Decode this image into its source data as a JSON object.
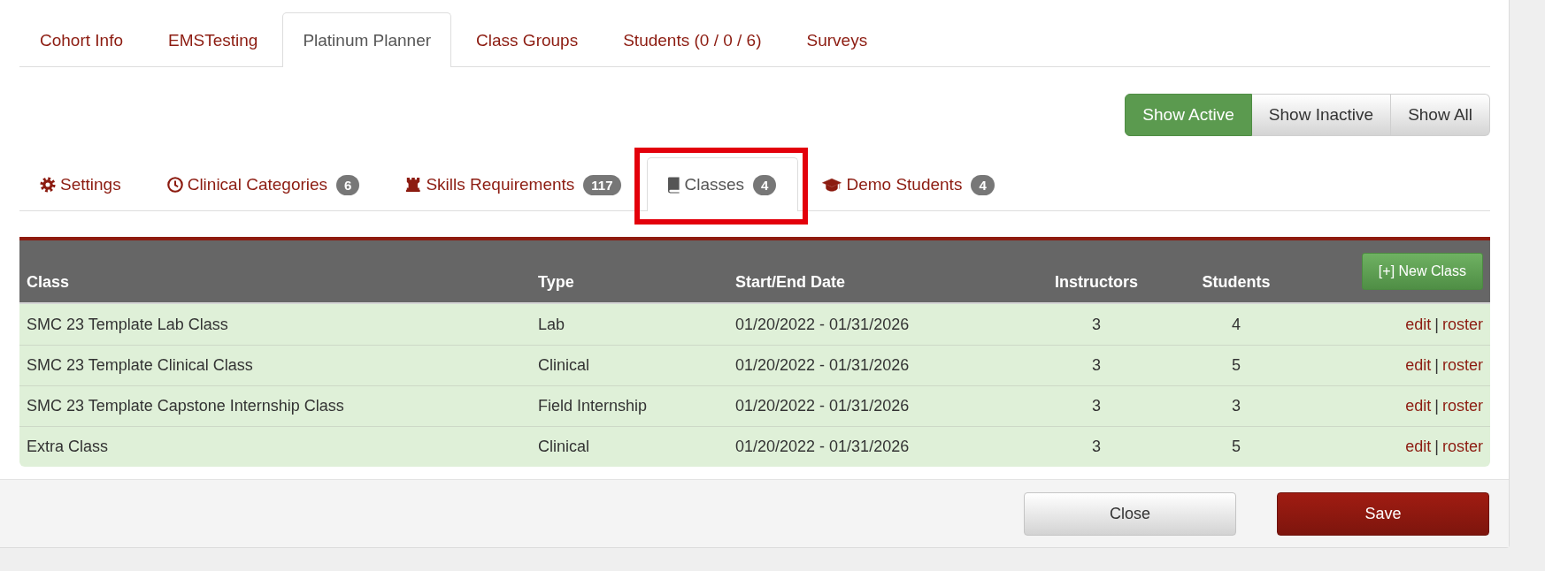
{
  "main_tabs": [
    {
      "label": "Cohort Info",
      "selected": false
    },
    {
      "label": "EMSTesting",
      "selected": false
    },
    {
      "label": "Platinum Planner",
      "selected": true
    },
    {
      "label": "Class Groups",
      "selected": false
    },
    {
      "label": "Students (0 / 0 / 6)",
      "selected": false
    },
    {
      "label": "Surveys",
      "selected": false
    }
  ],
  "filter_buttons": [
    {
      "label": "Show Active",
      "selected": true
    },
    {
      "label": "Show Inactive",
      "selected": false
    },
    {
      "label": "Show All",
      "selected": false
    }
  ],
  "sub_tabs": [
    {
      "label": "Settings",
      "selected": false,
      "highlighted": false
    },
    {
      "label": "Clinical Categories",
      "badge": "6",
      "selected": false,
      "highlighted": false
    },
    {
      "label": "Skills Requirements",
      "badge": "117",
      "selected": false,
      "highlighted": false
    },
    {
      "label": "Classes",
      "badge": "4",
      "selected": true,
      "highlighted": true
    },
    {
      "label": "Demo Students",
      "badge": "4",
      "selected": false,
      "highlighted": false
    }
  ],
  "table": {
    "columns": [
      "Class",
      "Type",
      "Start/End Date",
      "Instructors",
      "Students"
    ],
    "new_button": "[+] New Class",
    "rows": [
      {
        "class": "SMC 23 Template Lab Class",
        "type": "Lab",
        "dates": "01/20/2022 - 01/31/2026",
        "instructors": "3",
        "students": "4",
        "actions": [
          {
            "label": "edit",
            "kind": "link"
          },
          {
            "label": "|",
            "kind": "separator"
          },
          {
            "label": "roster",
            "kind": "link"
          }
        ]
      },
      {
        "class": "SMC 23 Template Clinical Class",
        "type": "Clinical",
        "dates": "01/20/2022 - 01/31/2026",
        "instructors": "3",
        "students": "5",
        "actions": [
          {
            "label": "edit",
            "kind": "link"
          },
          {
            "label": "|",
            "kind": "separator"
          },
          {
            "label": "roster",
            "kind": "link"
          }
        ]
      },
      {
        "class": "SMC 23 Template Capstone Internship Class",
        "type": "Field Internship",
        "dates": "01/20/2022 - 01/31/2026",
        "instructors": "3",
        "students": "3",
        "actions": [
          {
            "label": "edit",
            "kind": "link"
          },
          {
            "label": "|",
            "kind": "separator"
          },
          {
            "label": "roster",
            "kind": "link"
          }
        ]
      },
      {
        "class": "Extra Class",
        "type": "Clinical",
        "dates": "01/20/2022 - 01/31/2026",
        "instructors": "3",
        "students": "5",
        "actions": [
          {
            "label": "edit",
            "kind": "link"
          },
          {
            "label": "|",
            "kind": "separator"
          },
          {
            "label": "roster",
            "kind": "link"
          }
        ]
      }
    ]
  },
  "footer": {
    "buttons": [
      {
        "label": "Close",
        "kind": "default"
      },
      {
        "label": "Save",
        "kind": "primary"
      }
    ]
  }
}
